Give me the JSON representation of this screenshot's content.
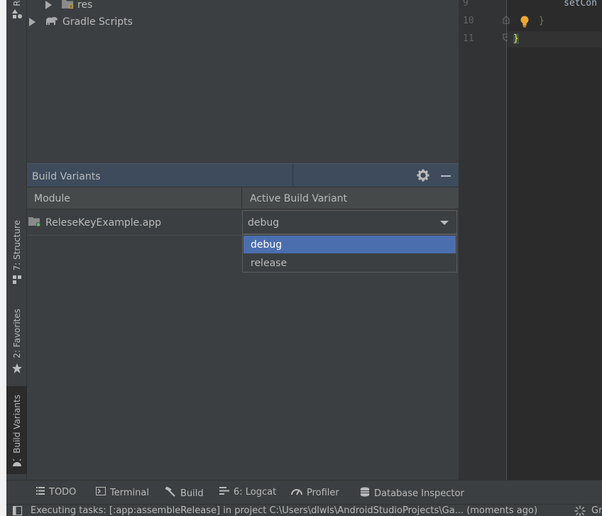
{
  "project_tree": {
    "items": [
      {
        "label": "res",
        "icon": "folder-icon"
      },
      {
        "label": "Gradle Scripts",
        "icon": "gradle-elephant-icon"
      }
    ]
  },
  "left_tool_tabs": [
    {
      "label": "Reso",
      "icon": "resource-manager-icon"
    },
    {
      "label": "7: Structure",
      "icon": "structure-icon"
    },
    {
      "label": "2: Favorites",
      "icon": "star-icon"
    },
    {
      "label": "Build Variants",
      "icon": "android-icon"
    }
  ],
  "build_variants": {
    "title": "Build Variants",
    "columns": [
      "Module",
      "Active Build Variant"
    ],
    "rows": [
      {
        "module": "ReleseKeyExample.app",
        "variant": "debug"
      }
    ],
    "dropdown_options": [
      "debug",
      "release"
    ],
    "selected_option": "debug"
  },
  "editor": {
    "line_numbers": [
      "9",
      "10",
      "11"
    ],
    "lines": [
      "setCon",
      "}",
      "}"
    ]
  },
  "bottom_tabs": [
    {
      "label": "TODO",
      "icon": "list-icon"
    },
    {
      "label": "Terminal",
      "icon": "terminal-icon"
    },
    {
      "label": "Build",
      "icon": "hammer-icon"
    },
    {
      "label": "6: Logcat",
      "icon": "logcat-icon"
    },
    {
      "label": "Profiler",
      "icon": "gauge-icon"
    },
    {
      "label": "Database Inspector",
      "icon": "database-icon"
    }
  ],
  "status": {
    "text": "Executing tasks: [:app:assembleRelease] in project C:\\Users\\dlwls\\AndroidStudioProjects\\Ga... (moments ago)",
    "trailing": "Gr"
  },
  "colors": {
    "selection": "#4b6eaf",
    "header": "#3d4b5c",
    "background": "#3c3f41",
    "editor": "#2b2b2b",
    "bulb": "#f0a732",
    "brace": "#6a8759"
  }
}
